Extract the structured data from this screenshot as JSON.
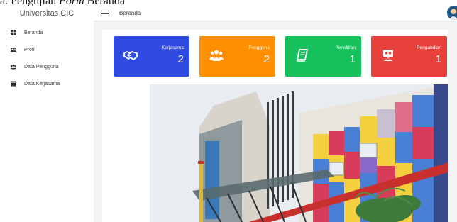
{
  "caption": {
    "prefix": "a.  Pengujian ",
    "italic": "Form",
    "suffix": " Beranda"
  },
  "sidebar": {
    "brand": "Universitas CIC",
    "items": [
      {
        "label": "Beranda",
        "icon": "dashboard-icon"
      },
      {
        "label": "Profil",
        "icon": "id-card-icon"
      },
      {
        "label": "Data Pengguna",
        "icon": "users-icon"
      },
      {
        "label": "Data Kerjasama",
        "icon": "archive-icon"
      }
    ]
  },
  "topbar": {
    "breadcrumb": "Beranda",
    "menu_icon": "hamburger-icon",
    "avatar_icon": "user-avatar"
  },
  "cards": [
    {
      "label": "Kerjasama",
      "value": "2",
      "color": "#2f4be0",
      "icon": "handshake-icon"
    },
    {
      "label": "Pengguna",
      "value": "2",
      "color": "#ff8f00",
      "icon": "users-icon"
    },
    {
      "label": "Penelitian",
      "value": "1",
      "color": "#16c05a",
      "icon": "book-icon"
    },
    {
      "label": "Pengabdian",
      "value": "1",
      "color": "#e8403a",
      "icon": "community-icon"
    }
  ],
  "hero": {
    "icon": "campus-building-photo"
  }
}
